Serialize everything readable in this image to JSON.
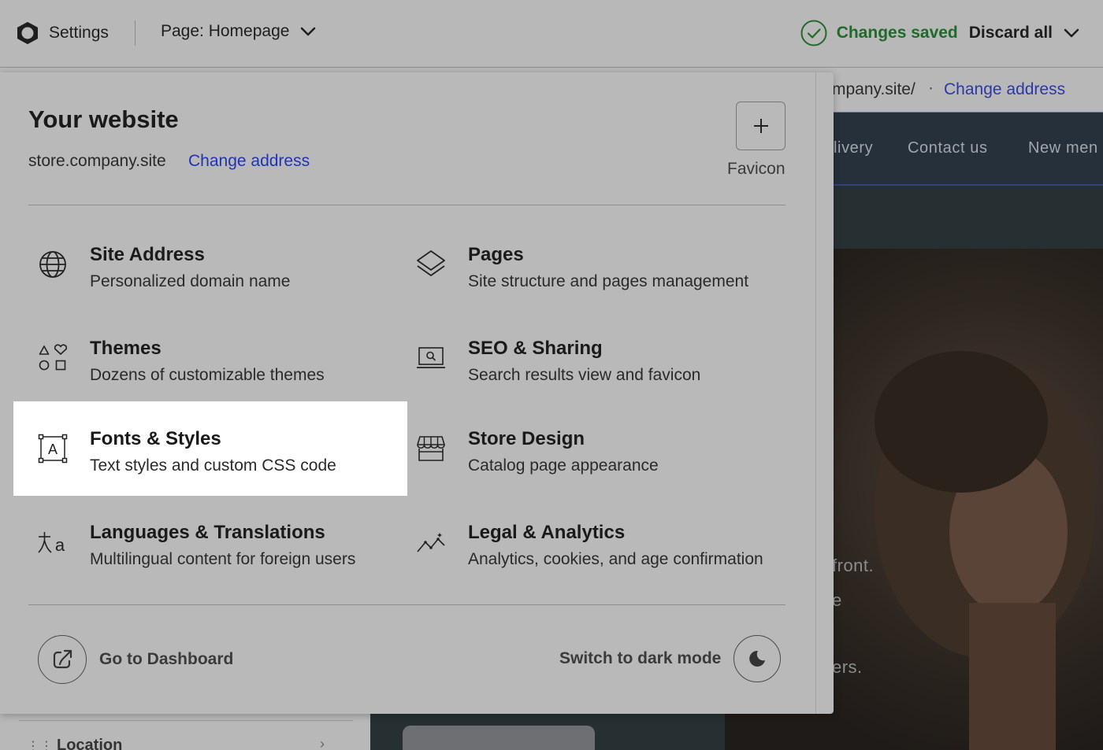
{
  "topbar": {
    "settings_label": "Settings",
    "page_selector": "Page: Homepage",
    "status": "Changes saved",
    "discard": "Discard all",
    "status_color": "#1f6b2a"
  },
  "preview": {
    "address_text": "mpany.site/",
    "address_dot": "·",
    "change_address": "Change address",
    "nav": [
      "livery",
      "Contact us",
      "New men"
    ],
    "hero_lines": [
      "front.",
      "e",
      "ers."
    ]
  },
  "sidebar_under": {
    "item_label": "Location",
    "drag_handle": "⋮⋮",
    "chevron": "›"
  },
  "panel": {
    "title": "Your website",
    "domain": "store.company.site",
    "change_address": "Change address",
    "favicon_label": "Favicon",
    "items": [
      {
        "icon": "globe-icon",
        "title": "Site Address",
        "desc": "Personalized domain name"
      },
      {
        "icon": "layers-icon",
        "title": "Pages",
        "desc": "Site structure and pages management"
      },
      {
        "icon": "shapes-icon",
        "title": "Themes",
        "desc": "Dozens of customizable themes"
      },
      {
        "icon": "seo-laptop-icon",
        "title": "SEO & Sharing",
        "desc": "Search results view and favicon"
      },
      {
        "icon": "font-frame-icon",
        "title": "Fonts & Styles",
        "desc": "Text styles and custom CSS code"
      },
      {
        "icon": "storefront-icon",
        "title": "Store Design",
        "desc": "Catalog page appearance"
      },
      {
        "icon": "translate-icon",
        "title": "Languages & Translations",
        "desc": "Multilingual content for foreign users"
      },
      {
        "icon": "analytics-icon",
        "title": "Legal & Analytics",
        "desc": "Analytics, cookies, and age confirmation"
      }
    ],
    "active_item": "Fonts & Styles",
    "dashboard_label": "Go to Dashboard",
    "dark_mode_label": "Switch to dark mode"
  }
}
